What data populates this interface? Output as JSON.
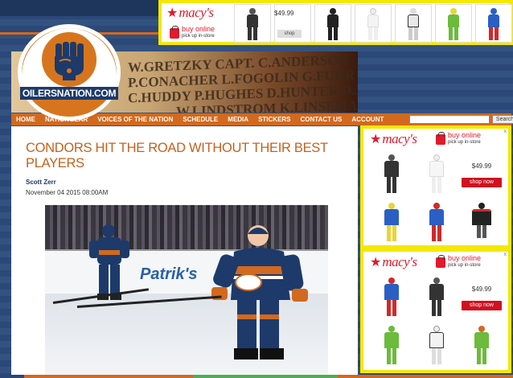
{
  "site": {
    "logo_text": "OILERSNATION.COM",
    "banner_engraving": [
      "W.GRETZKY CAPT. C.ANDERSON",
      "P.CONACHER L.FOGOLIN G.FUHR R.GREGG",
      "C.HUDDY P.HUGHES D.HUNTER D.JACKSON",
      "W.LINDSTROM K.LINSEMAN"
    ]
  },
  "nav": {
    "items": [
      "HOME",
      "NATIONGEAR",
      "VOICES OF THE NATION",
      "SCHEDULE",
      "MEDIA",
      "STICKERS",
      "CONTACT US",
      "ACCOUNT"
    ],
    "search_placeholder": "",
    "search_button": "Search"
  },
  "article": {
    "title": "CONDORS HIT THE ROAD WITHOUT THEIR BEST PLAYERS",
    "author": "Scott Zerr",
    "date": "November 04 2015 08:00AM",
    "photo_board_text": "Patrik's"
  },
  "ads": {
    "brand": "macy's",
    "buy_online": "buy online",
    "pickup": "pick up in-store",
    "price": "$49.99",
    "shop_now": "shop now",
    "shop_small": "shop",
    "ad_marker": "x",
    "colors": {
      "yellow_border": "#f5e800",
      "macys_red": "#e21a2c"
    }
  }
}
